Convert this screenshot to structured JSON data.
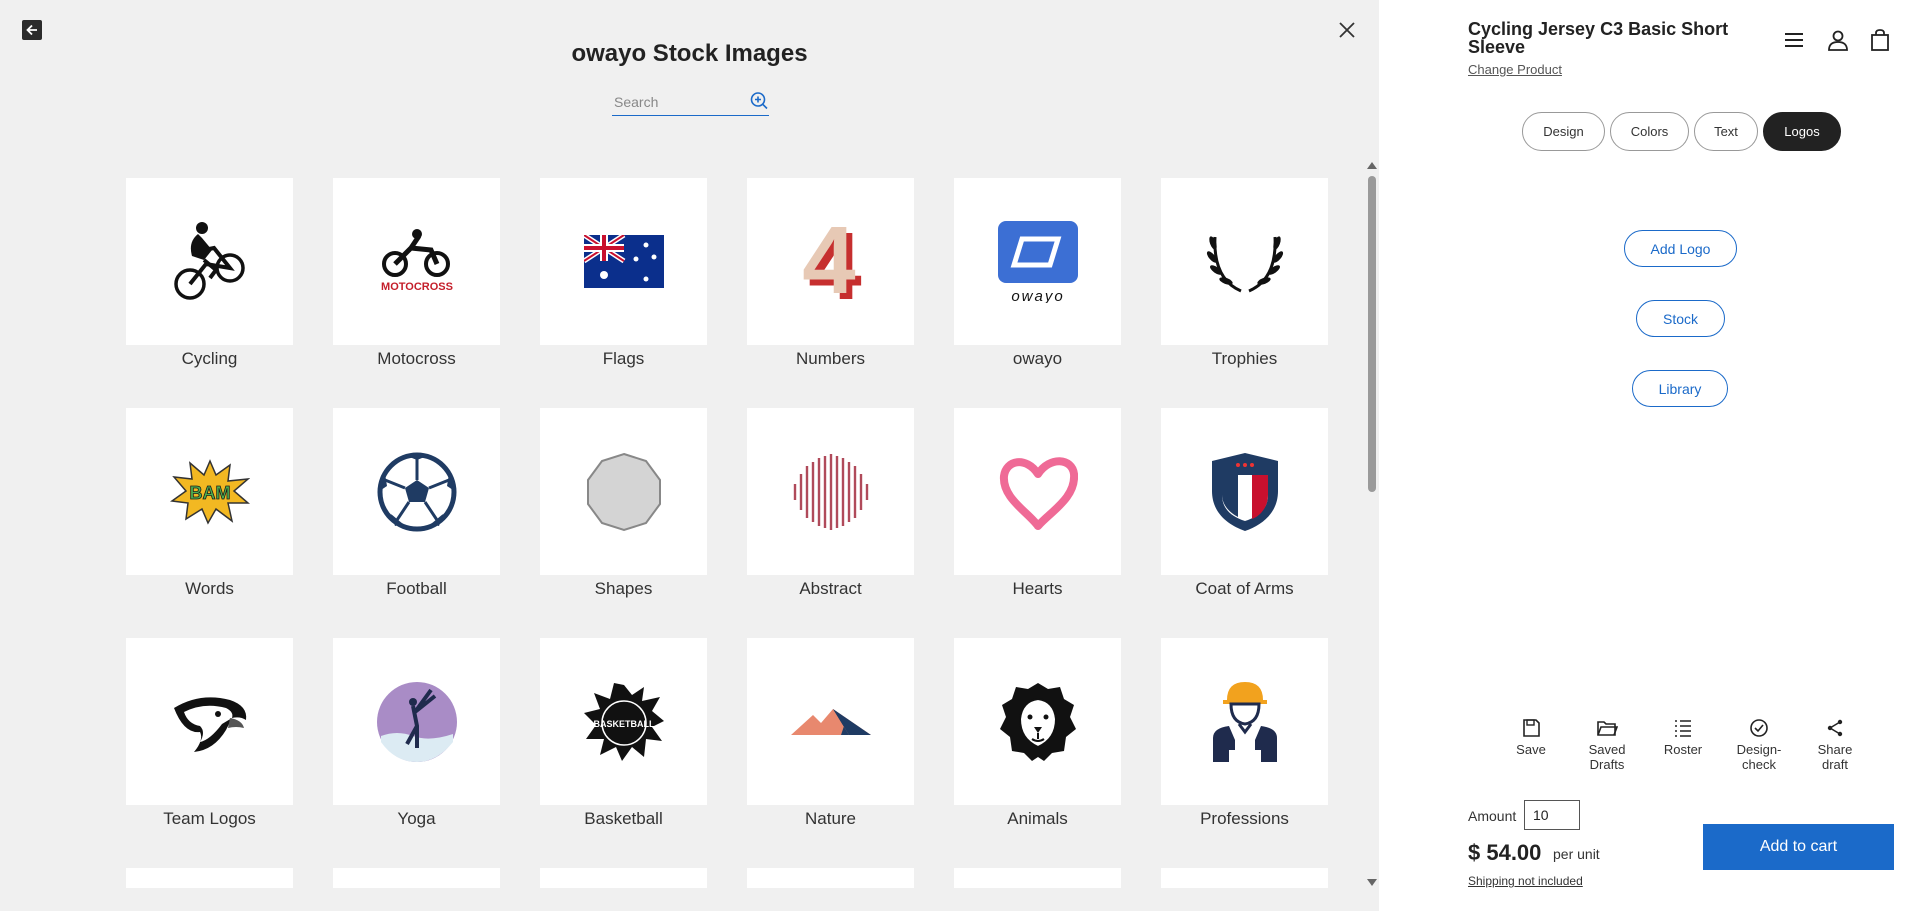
{
  "modal": {
    "title": "owayo Stock Images",
    "search_placeholder": "Search",
    "categories": [
      {
        "label": "Cycling",
        "icon": "cyclist-icon"
      },
      {
        "label": "Motocross",
        "icon": "motocross-icon",
        "thumb_text": "MOTOCROSS"
      },
      {
        "label": "Flags",
        "icon": "australia-flag-icon"
      },
      {
        "label": "Numbers",
        "icon": "number-4-icon",
        "thumb_text": "4"
      },
      {
        "label": "owayo",
        "icon": "owayo-logo-icon",
        "thumb_text": "owayo"
      },
      {
        "label": "Trophies",
        "icon": "laurel-wreath-icon"
      },
      {
        "label": "Words",
        "icon": "bam-burst-icon",
        "thumb_text": "BAM"
      },
      {
        "label": "Football",
        "icon": "soccer-ball-icon"
      },
      {
        "label": "Shapes",
        "icon": "decagon-icon"
      },
      {
        "label": "Abstract",
        "icon": "abstract-lines-icon"
      },
      {
        "label": "Hearts",
        "icon": "heart-icon"
      },
      {
        "label": "Coat of Arms",
        "icon": "shield-crest-icon"
      },
      {
        "label": "Team Logos",
        "icon": "eagle-head-icon"
      },
      {
        "label": "Yoga",
        "icon": "yoga-pose-icon"
      },
      {
        "label": "Basketball",
        "icon": "basketball-splash-icon",
        "thumb_text": "BASKETBALL"
      },
      {
        "label": "Nature",
        "icon": "mountain-icon"
      },
      {
        "label": "Animals",
        "icon": "lion-head-icon"
      },
      {
        "label": "Professions",
        "icon": "construction-worker-icon"
      }
    ]
  },
  "side": {
    "product_title": "Cycling Jersey C3 Basic Short Sleeve",
    "change_product": "Change Product",
    "tabs": [
      {
        "label": "Design",
        "active": false
      },
      {
        "label": "Colors",
        "active": false
      },
      {
        "label": "Text",
        "active": false
      },
      {
        "label": "Logos",
        "active": true
      }
    ],
    "add_logo": "Add Logo",
    "stock": "Stock",
    "library": "Library",
    "tools": {
      "save": "Save",
      "saved_drafts_1": "Saved",
      "saved_drafts_2": "Drafts",
      "roster": "Roster",
      "design_check_1": "Design-",
      "design_check_2": "check",
      "share_1": "Share",
      "share_2": "draft"
    },
    "amount_label": "Amount",
    "amount_value": "10",
    "price": "$ 54.00",
    "per_unit": "per unit",
    "shipping": "Shipping not included",
    "add_to_cart": "Add to cart"
  },
  "colors": {
    "accent": "#1b6ac9",
    "modal_bg": "#f0f0f0",
    "active_tab": "#222222"
  }
}
